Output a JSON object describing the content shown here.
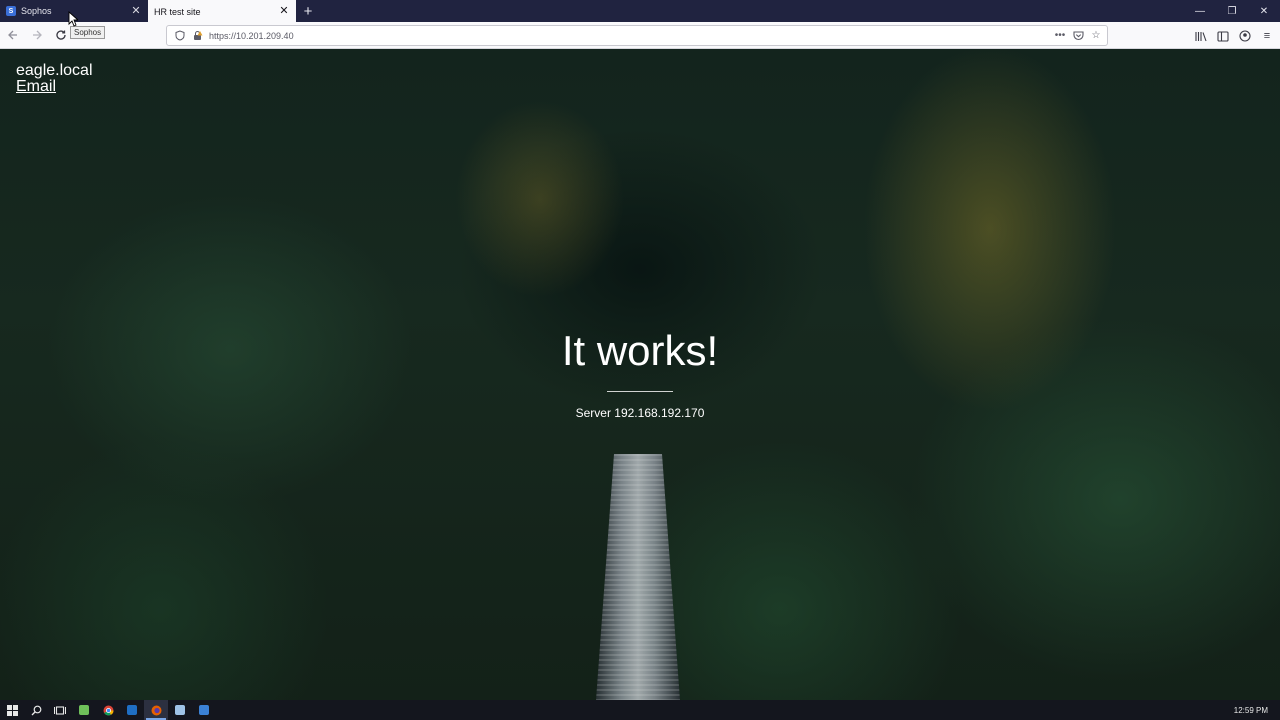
{
  "browser": {
    "tabs": [
      {
        "title": "Sophos",
        "favicon": "S",
        "active": false
      },
      {
        "title": "HR test site",
        "active": true
      }
    ],
    "new_tab_symbol": "+",
    "tooltip": "Sophos",
    "url": "https://10.201.209.40",
    "icons": {
      "back": "back-arrow-icon",
      "forward": "forward-arrow-icon",
      "reload": "reload-icon",
      "menu": "hamburger-menu-icon"
    }
  },
  "page": {
    "site_name": "eagle.local",
    "email_link": "Email",
    "title": "It works!",
    "subtitle": "Server 192.168.192.170"
  },
  "taskbar": {
    "clock": "12:59 PM"
  },
  "colors": {
    "tab_strip": "#202340",
    "toolbar": "#f9f9fb",
    "taskbar": "#14161e",
    "page_text": "#ffffff"
  }
}
